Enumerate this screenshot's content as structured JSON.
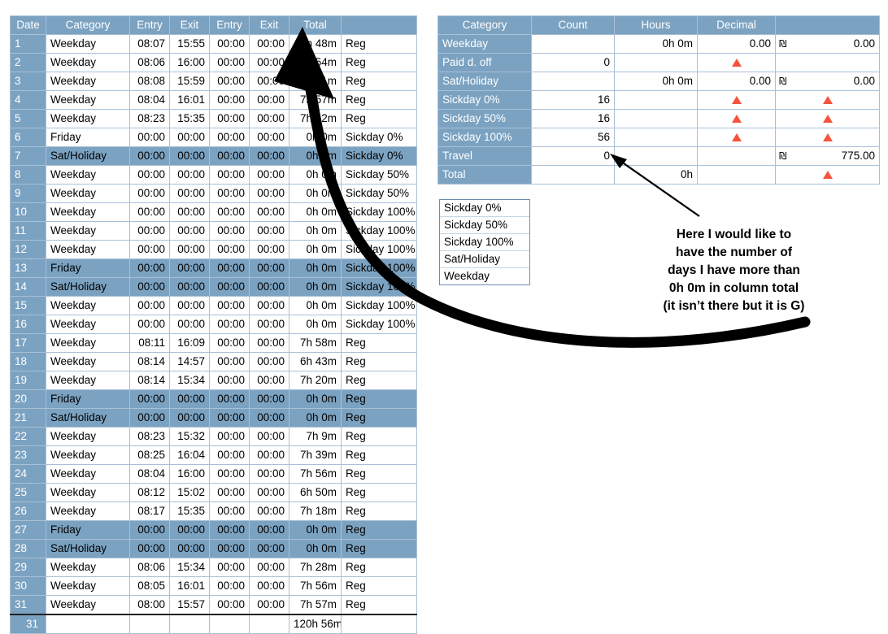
{
  "timesheet": {
    "columns": [
      "Date",
      "Category",
      "Entry",
      "Exit",
      "Entry",
      "Exit",
      "Total",
      ""
    ],
    "rows": [
      {
        "date": "1",
        "category": "Weekday",
        "entry1": "08:07",
        "exit1": "15:55",
        "entry2": "00:00",
        "exit2": "00:00",
        "total": "7h 48m",
        "note": "Reg",
        "selected": false
      },
      {
        "date": "2",
        "category": "Weekday",
        "entry1": "08:06",
        "exit1": "16:00",
        "entry2": "00:00",
        "exit2": "00:00",
        "total": "7h 54m",
        "note": "Reg",
        "selected": false
      },
      {
        "date": "3",
        "category": "Weekday",
        "entry1": "08:08",
        "exit1": "15:59",
        "entry2": "00:00",
        "exit2": "00:00",
        "total": "7h 51m",
        "note": "Reg",
        "selected": false
      },
      {
        "date": "4",
        "category": "Weekday",
        "entry1": "08:04",
        "exit1": "16:01",
        "entry2": "00:00",
        "exit2": "00:00",
        "total": "7h 57m",
        "note": "Reg",
        "selected": false
      },
      {
        "date": "5",
        "category": "Weekday",
        "entry1": "08:23",
        "exit1": "15:35",
        "entry2": "00:00",
        "exit2": "00:00",
        "total": "7h 12m",
        "note": "Reg",
        "selected": false
      },
      {
        "date": "6",
        "category": "Friday",
        "entry1": "00:00",
        "exit1": "00:00",
        "entry2": "00:00",
        "exit2": "00:00",
        "total": "0h 0m",
        "note": "Sickday 0%",
        "selected": false
      },
      {
        "date": "7",
        "category": "Sat/Holiday",
        "entry1": "00:00",
        "exit1": "00:00",
        "entry2": "00:00",
        "exit2": "00:00",
        "total": "0h 0m",
        "note": "Sickday 0%",
        "selected": true
      },
      {
        "date": "8",
        "category": "Weekday",
        "entry1": "00:00",
        "exit1": "00:00",
        "entry2": "00:00",
        "exit2": "00:00",
        "total": "0h 0m",
        "note": "Sickday 50%",
        "selected": false
      },
      {
        "date": "9",
        "category": "Weekday",
        "entry1": "00:00",
        "exit1": "00:00",
        "entry2": "00:00",
        "exit2": "00:00",
        "total": "0h 0m",
        "note": "Sickday 50%",
        "selected": false
      },
      {
        "date": "10",
        "category": "Weekday",
        "entry1": "00:00",
        "exit1": "00:00",
        "entry2": "00:00",
        "exit2": "00:00",
        "total": "0h 0m",
        "note": "Sickday 100%",
        "selected": false
      },
      {
        "date": "11",
        "category": "Weekday",
        "entry1": "00:00",
        "exit1": "00:00",
        "entry2": "00:00",
        "exit2": "00:00",
        "total": "0h 0m",
        "note": "Sickday 100%",
        "selected": false
      },
      {
        "date": "12",
        "category": "Weekday",
        "entry1": "00:00",
        "exit1": "00:00",
        "entry2": "00:00",
        "exit2": "00:00",
        "total": "0h 0m",
        "note": "Sickday 100%",
        "selected": false
      },
      {
        "date": "13",
        "category": "Friday",
        "entry1": "00:00",
        "exit1": "00:00",
        "entry2": "00:00",
        "exit2": "00:00",
        "total": "0h 0m",
        "note": "Sickday 100%",
        "selected": true
      },
      {
        "date": "14",
        "category": "Sat/Holiday",
        "entry1": "00:00",
        "exit1": "00:00",
        "entry2": "00:00",
        "exit2": "00:00",
        "total": "0h 0m",
        "note": "Sickday 100%",
        "selected": true
      },
      {
        "date": "15",
        "category": "Weekday",
        "entry1": "00:00",
        "exit1": "00:00",
        "entry2": "00:00",
        "exit2": "00:00",
        "total": "0h 0m",
        "note": "Sickday 100%",
        "selected": false
      },
      {
        "date": "16",
        "category": "Weekday",
        "entry1": "00:00",
        "exit1": "00:00",
        "entry2": "00:00",
        "exit2": "00:00",
        "total": "0h 0m",
        "note": "Sickday 100%",
        "selected": false
      },
      {
        "date": "17",
        "category": "Weekday",
        "entry1": "08:11",
        "exit1": "16:09",
        "entry2": "00:00",
        "exit2": "00:00",
        "total": "7h 58m",
        "note": "Reg",
        "selected": false
      },
      {
        "date": "18",
        "category": "Weekday",
        "entry1": "08:14",
        "exit1": "14:57",
        "entry2": "00:00",
        "exit2": "00:00",
        "total": "6h 43m",
        "note": "Reg",
        "selected": false
      },
      {
        "date": "19",
        "category": "Weekday",
        "entry1": "08:14",
        "exit1": "15:34",
        "entry2": "00:00",
        "exit2": "00:00",
        "total": "7h 20m",
        "note": "Reg",
        "selected": false
      },
      {
        "date": "20",
        "category": "Friday",
        "entry1": "00:00",
        "exit1": "00:00",
        "entry2": "00:00",
        "exit2": "00:00",
        "total": "0h 0m",
        "note": "Reg",
        "selected": true
      },
      {
        "date": "21",
        "category": "Sat/Holiday",
        "entry1": "00:00",
        "exit1": "00:00",
        "entry2": "00:00",
        "exit2": "00:00",
        "total": "0h 0m",
        "note": "Reg",
        "selected": true
      },
      {
        "date": "22",
        "category": "Weekday",
        "entry1": "08:23",
        "exit1": "15:32",
        "entry2": "00:00",
        "exit2": "00:00",
        "total": "7h 9m",
        "note": "Reg",
        "selected": false
      },
      {
        "date": "23",
        "category": "Weekday",
        "entry1": "08:25",
        "exit1": "16:04",
        "entry2": "00:00",
        "exit2": "00:00",
        "total": "7h 39m",
        "note": "Reg",
        "selected": false
      },
      {
        "date": "24",
        "category": "Weekday",
        "entry1": "08:04",
        "exit1": "16:00",
        "entry2": "00:00",
        "exit2": "00:00",
        "total": "7h 56m",
        "note": "Reg",
        "selected": false
      },
      {
        "date": "25",
        "category": "Weekday",
        "entry1": "08:12",
        "exit1": "15:02",
        "entry2": "00:00",
        "exit2": "00:00",
        "total": "6h 50m",
        "note": "Reg",
        "selected": false
      },
      {
        "date": "26",
        "category": "Weekday",
        "entry1": "08:17",
        "exit1": "15:35",
        "entry2": "00:00",
        "exit2": "00:00",
        "total": "7h 18m",
        "note": "Reg",
        "selected": false
      },
      {
        "date": "27",
        "category": "Friday",
        "entry1": "00:00",
        "exit1": "00:00",
        "entry2": "00:00",
        "exit2": "00:00",
        "total": "0h 0m",
        "note": "Reg",
        "selected": true
      },
      {
        "date": "28",
        "category": "Sat/Holiday",
        "entry1": "00:00",
        "exit1": "00:00",
        "entry2": "00:00",
        "exit2": "00:00",
        "total": "0h 0m",
        "note": "Reg",
        "selected": true
      },
      {
        "date": "29",
        "category": "Weekday",
        "entry1": "08:06",
        "exit1": "15:34",
        "entry2": "00:00",
        "exit2": "00:00",
        "total": "7h 28m",
        "note": "Reg",
        "selected": false
      },
      {
        "date": "30",
        "category": "Weekday",
        "entry1": "08:05",
        "exit1": "16:01",
        "entry2": "00:00",
        "exit2": "00:00",
        "total": "7h 56m",
        "note": "Reg",
        "selected": false
      },
      {
        "date": "31",
        "category": "Weekday",
        "entry1": "08:00",
        "exit1": "15:57",
        "entry2": "00:00",
        "exit2": "00:00",
        "total": "7h 57m",
        "note": "Reg",
        "selected": false
      }
    ],
    "footer": {
      "date": "31",
      "category": "",
      "entry1": "",
      "exit1": "",
      "entry2": "",
      "exit2": "",
      "total": "120h 56m",
      "note": ""
    }
  },
  "summary": {
    "columns": [
      "Category",
      "Count",
      "Hours",
      "Decimal",
      ""
    ],
    "currency_symbol": "₪",
    "rows": [
      {
        "category": "Weekday",
        "count": "",
        "hours": "0h 0m",
        "decimal": "0.00",
        "decimal_warn": false,
        "money": "0.00",
        "money_warn": false,
        "show_currency": true
      },
      {
        "category": "Paid d. off",
        "count": "0",
        "hours": "",
        "decimal": "",
        "decimal_warn": true,
        "money": "",
        "money_warn": false,
        "show_currency": false
      },
      {
        "category": "Sat/Holiday",
        "count": "",
        "hours": "0h 0m",
        "decimal": "0.00",
        "decimal_warn": false,
        "money": "0.00",
        "money_warn": false,
        "show_currency": true
      },
      {
        "category": "Sickday 0%",
        "count": "16",
        "hours": "",
        "decimal": "",
        "decimal_warn": true,
        "money": "",
        "money_warn": true,
        "show_currency": false
      },
      {
        "category": "Sickday 50%",
        "count": "16",
        "hours": "",
        "decimal": "",
        "decimal_warn": true,
        "money": "",
        "money_warn": true,
        "show_currency": false
      },
      {
        "category": "Sickday 100%",
        "count": "56",
        "hours": "",
        "decimal": "",
        "decimal_warn": true,
        "money": "",
        "money_warn": true,
        "show_currency": false
      },
      {
        "category": "Travel",
        "count": "0",
        "hours": "",
        "decimal": "",
        "decimal_warn": false,
        "money": "775.00",
        "money_warn": false,
        "show_currency": true
      },
      {
        "category": "Total",
        "count": "",
        "hours": "0h",
        "decimal": "",
        "decimal_warn": false,
        "money": "",
        "money_warn": true,
        "show_currency": false
      }
    ]
  },
  "dropdown": {
    "options": [
      "Sickday 0%",
      "Sickday 50%",
      "Sickday 100%",
      "Sat/Holiday",
      "Weekday"
    ]
  },
  "annotation": {
    "line1": "Here I would like to",
    "line2": "have the number of",
    "line3": "days I have more than",
    "line4": "0h 0m in column total",
    "line5": "(it isn’t there but it is G)"
  },
  "colors": {
    "header_blue": "#7ba2c1",
    "grid_blue": "#a9c0d6",
    "warning_red": "#f4543c",
    "annotation_black": "#000000"
  }
}
